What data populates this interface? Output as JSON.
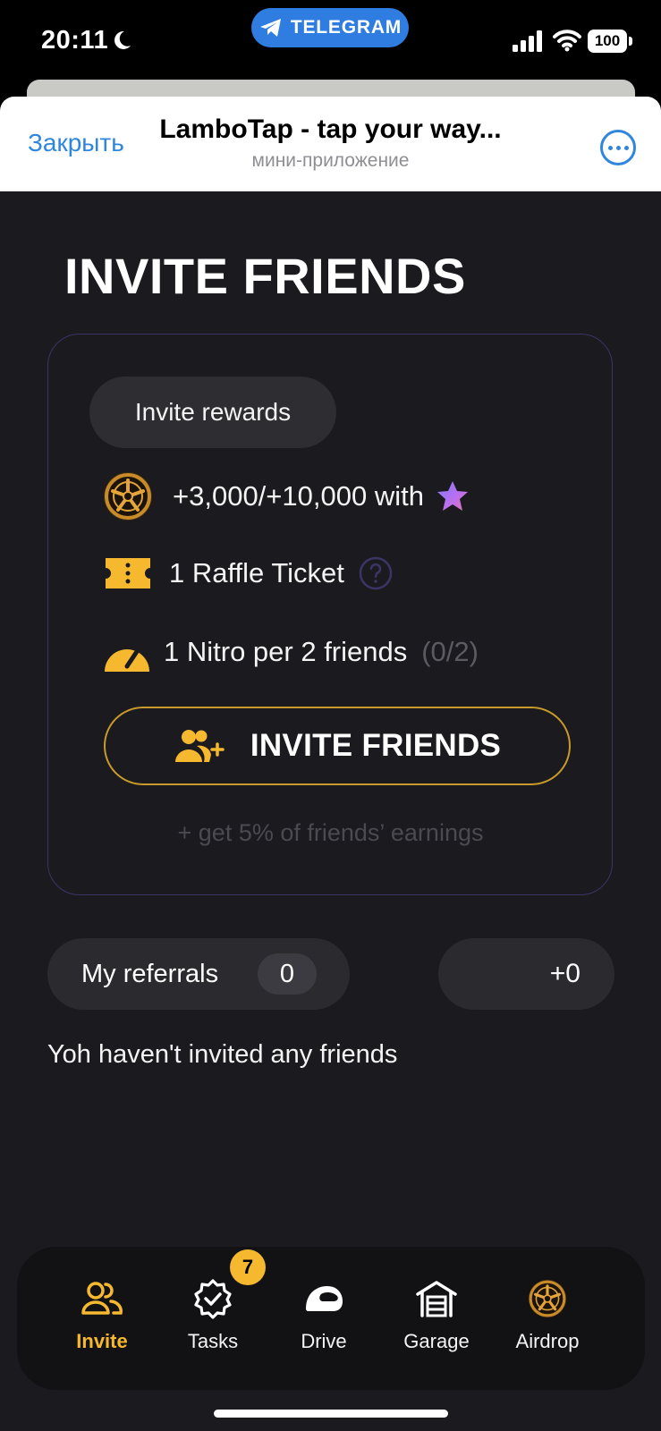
{
  "status_bar": {
    "time": "20:11",
    "pill_label": "TELEGRAM",
    "battery": "100"
  },
  "header": {
    "close_label": "Закрыть",
    "title": "LamboTap - tap your way...",
    "subtitle": "мини-приложение"
  },
  "invite": {
    "title": "INVITE FRIENDS",
    "rewards_label": "Invite rewards",
    "rewards": [
      {
        "icon": "wheel-coin-icon",
        "text": "+3,000/+10,000 with",
        "extra_icon": "premium-star-icon"
      },
      {
        "icon": "raffle-ticket-icon",
        "text": "1 Raffle Ticket",
        "extra_icon": "help-icon"
      },
      {
        "icon": "nitro-gauge-icon",
        "text": "1 Nitro per 2 friends",
        "progress": "(0/2)"
      }
    ],
    "button_label": "INVITE FRIENDS",
    "earnings_note": "+ get 5% of friends’ earnings"
  },
  "referrals": {
    "label": "My referrals",
    "count": "0",
    "earned": "+0",
    "empty_message": "Yoh haven't invited any friends"
  },
  "nav": {
    "items": [
      {
        "label": "Invite",
        "icon": "people-icon",
        "active": true
      },
      {
        "label": "Tasks",
        "icon": "badge-check-icon",
        "badge": "7"
      },
      {
        "label": "Drive",
        "icon": "helmet-icon"
      },
      {
        "label": "Garage",
        "icon": "garage-icon"
      },
      {
        "label": "Airdrop",
        "icon": "wheel-coin-icon"
      }
    ]
  },
  "colors": {
    "accent": "#f5b82e",
    "telegram_blue": "#2f86de",
    "background": "#1a1a1f",
    "card_border": "#3b3566",
    "button_border": "#c99a2a"
  }
}
